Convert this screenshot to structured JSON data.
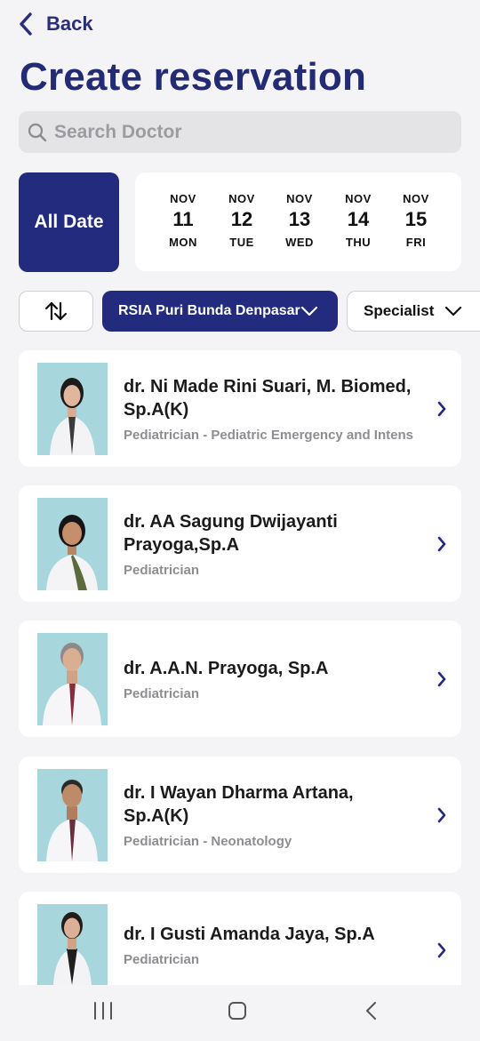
{
  "header": {
    "back_label": "Back",
    "title": "Create reservation"
  },
  "search": {
    "placeholder": "Search Doctor",
    "value": ""
  },
  "date_filter": {
    "all_label": "All Date",
    "dates": [
      {
        "month": "NOV",
        "day": "11",
        "weekday": "MON"
      },
      {
        "month": "NOV",
        "day": "12",
        "weekday": "TUE"
      },
      {
        "month": "NOV",
        "day": "13",
        "weekday": "WED"
      },
      {
        "month": "NOV",
        "day": "14",
        "weekday": "THU"
      },
      {
        "month": "NOV",
        "day": "15",
        "weekday": "FRI"
      }
    ]
  },
  "filters": {
    "sort_icon": "sort-arrows-icon",
    "hospital": "RSIA Puri Bunda Denpasar",
    "specialist": "Specialist"
  },
  "doctors": [
    {
      "name": "dr. Ni Made Rini Suari, M. Biomed, Sp.A(K)",
      "specialty": "Pediatrician - Pediatric Emergency and Intens"
    },
    {
      "name": "dr. AA Sagung Dwijayanti Prayoga,Sp.A",
      "specialty": "Pediatrician"
    },
    {
      "name": "dr. A.A.N. Prayoga, Sp.A",
      "specialty": "Pediatrician"
    },
    {
      "name": "dr. I Wayan Dharma Artana, Sp.A(K)",
      "specialty": "Pediatrician - Neonatology"
    },
    {
      "name": "dr. I Gusti Amanda Jaya, Sp.A",
      "specialty": "Pediatrician"
    }
  ],
  "colors": {
    "primary": "#232b7f",
    "photo_bg": "#a7d6dd",
    "page_bg": "#f4f4f6"
  }
}
